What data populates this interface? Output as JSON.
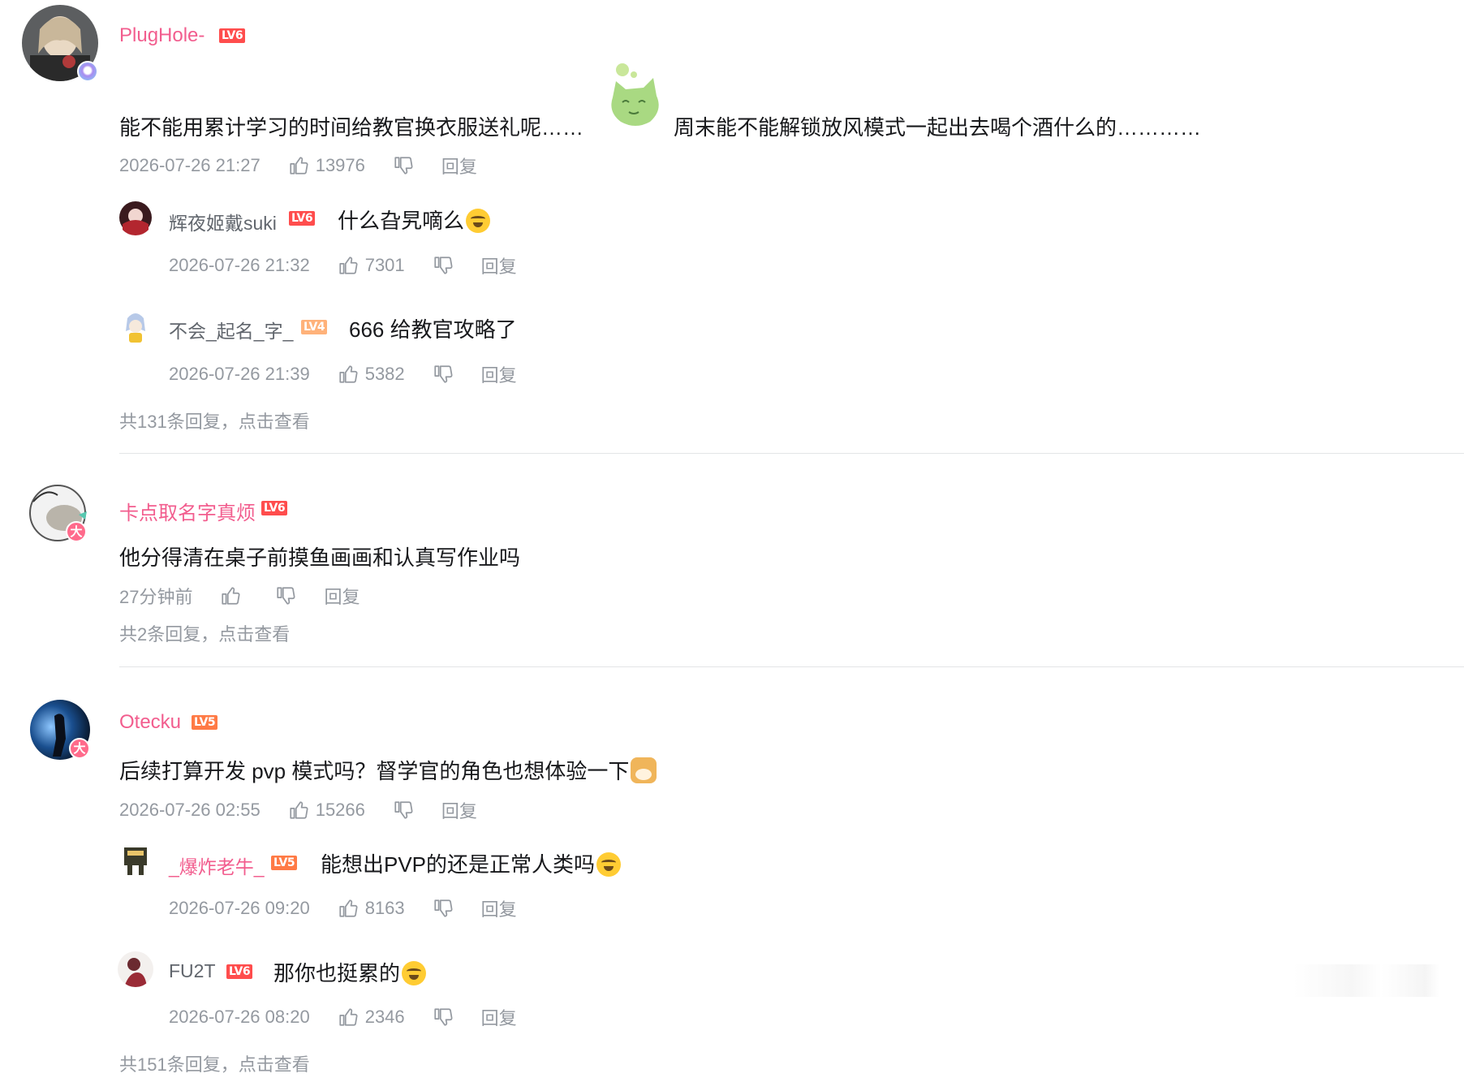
{
  "comments": [
    {
      "username": "PlugHole-",
      "level": "LV6",
      "content_before": "能不能用累计学习的时间给教官换衣服送礼呢……",
      "content_after": "周末能不能解锁放风模式一起出去喝个酒什么的…………",
      "sticker": "green-cat-sticker",
      "time": "2026-07-26 21:27",
      "likes": "13976",
      "reply_label": "回复",
      "replies": [
        {
          "username": "辉夜姬戴suki",
          "level": "LV6",
          "content": "什么旮旯嘀么",
          "emoji": "laugh-cry-emoji",
          "time": "2026-07-26 21:32",
          "likes": "7301",
          "reply_label": "回复"
        },
        {
          "username": "不会_起名_字_",
          "level": "LV4",
          "content": "666 给教官攻略了",
          "time": "2026-07-26 21:39",
          "likes": "5382",
          "reply_label": "回复"
        }
      ],
      "more": "共131条回复，点击查看"
    },
    {
      "username": "卡点取名字真烦",
      "level": "LV6",
      "badge": "大",
      "content": "他分得清在桌子前摸鱼画画和认真写作业吗",
      "time": "27分钟前",
      "likes": "",
      "reply_label": "回复",
      "more": "共2条回复，点击查看"
    },
    {
      "username": "Otecku",
      "level": "LV5",
      "badge": "大",
      "content": "后续打算开发 pvp 模式吗？督学官的角色也想体验一下",
      "emoji": "doge-emoji",
      "time": "2026-07-26 02:55",
      "likes": "15266",
      "reply_label": "回复",
      "replies": [
        {
          "username": "_爆炸老牛_",
          "level": "LV5",
          "content": "能想出PVP的还是正常人类吗",
          "emoji": "laugh-cry-emoji",
          "time": "2026-07-26 09:20",
          "likes": "8163",
          "reply_label": "回复"
        },
        {
          "username": "FU2T",
          "level": "LV6",
          "content": "那你也挺累的",
          "emoji": "laugh-cry-emoji",
          "time": "2026-07-26 08:20",
          "likes": "2346",
          "reply_label": "回复"
        }
      ],
      "more": "共151条回复，点击查看"
    }
  ],
  "colors": {
    "vip_name": "#f25d8e",
    "normal_name": "#61666d",
    "meta": "#9499a0",
    "divider": "#e3e5e7"
  }
}
